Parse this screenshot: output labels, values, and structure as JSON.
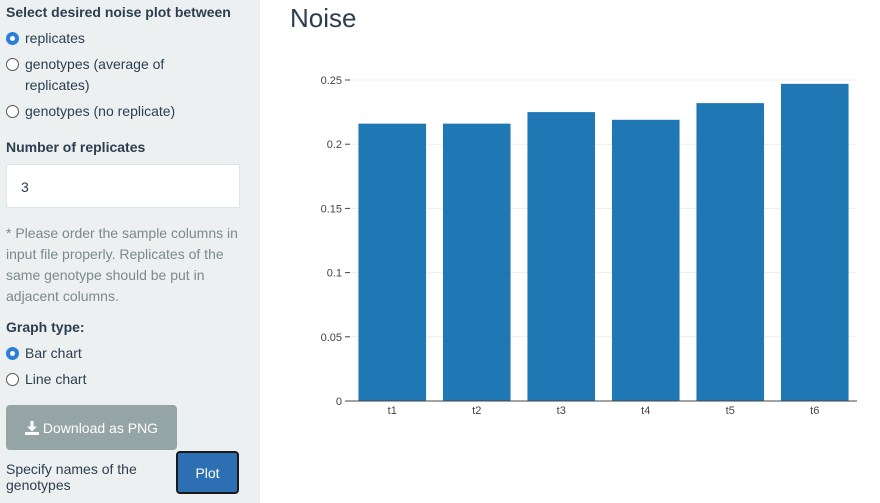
{
  "sidebar": {
    "noise_heading": "Select desired noise plot between",
    "noise_options": [
      {
        "label": "replicates",
        "checked": true
      },
      {
        "label_line1": "genotypes (average of",
        "label_line2": "replicates)",
        "checked": false
      },
      {
        "label": "genotypes (no replicate)",
        "checked": false
      }
    ],
    "replicates_heading": "Number of replicates",
    "replicates_value": "3",
    "help_text": "* Please order the sample columns in input file properly. Replicates of the same genotype should be put in adjacent columns.",
    "graph_type_heading": "Graph type:",
    "graph_type_options": [
      {
        "label": "Bar chart",
        "checked": true
      },
      {
        "label": "Line chart",
        "checked": false
      }
    ],
    "download_label": "Download as PNG",
    "download_icon": "download-icon",
    "specify_label": "Specify names of the genotypes",
    "plot_label": "Plot"
  },
  "main": {
    "title": "Noise"
  },
  "colors": {
    "bar": "#1f77b4",
    "sidebar_bg": "#ecf0f1",
    "plot_button": "#2c6fb3",
    "download_button": "#95a5a6"
  },
  "chart_data": {
    "type": "bar",
    "categories": [
      "t1",
      "t2",
      "t3",
      "t4",
      "t5",
      "t6"
    ],
    "values": [
      0.216,
      0.216,
      0.225,
      0.219,
      0.232,
      0.247
    ],
    "yticks": [
      "0",
      "0.05",
      "0.1",
      "0.15",
      "0.2",
      "0.25"
    ],
    "ylim": [
      0,
      0.25
    ],
    "grid": true
  }
}
